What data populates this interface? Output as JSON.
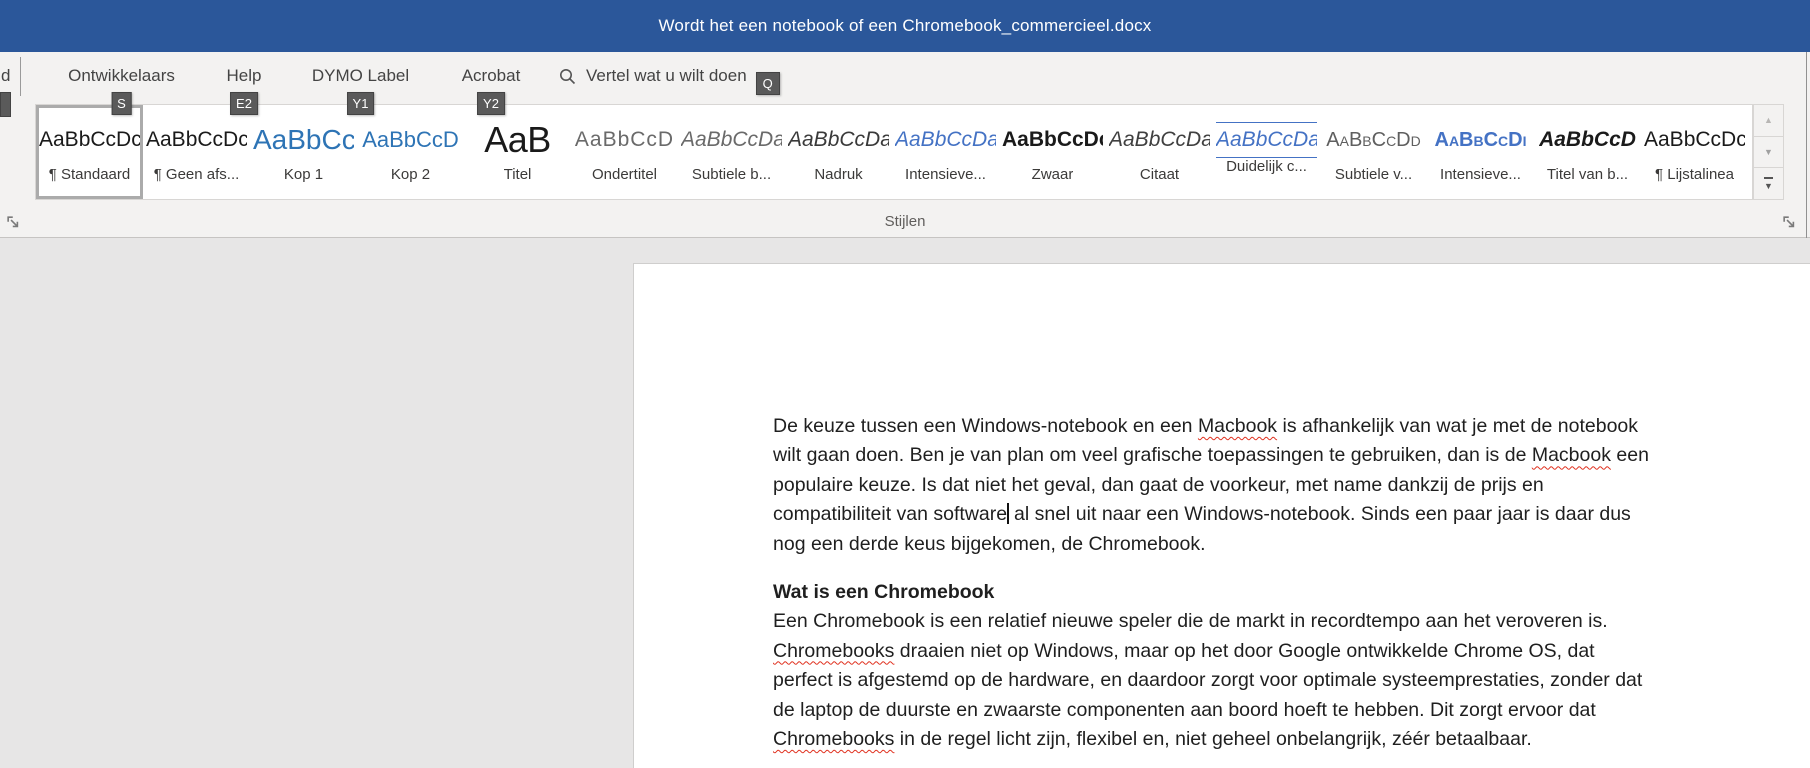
{
  "colors": {
    "title_bar_blue": "#2B579A",
    "ribbon_background": "#F3F2F1",
    "heading_blue": "#2E74B5",
    "intense_blue": "#4472C4",
    "keytip_background": "#5A5A5A",
    "spellcheck_red": "#E0301E"
  },
  "title_bar": {
    "document_title": "Wordt het een notebook of een Chromebook_commercieel.docx"
  },
  "menu": {
    "partial_tab_label": "d",
    "tabs": [
      {
        "label": "Ontwikkelaars",
        "keytip": "S"
      },
      {
        "label": "Help",
        "keytip": "E2"
      },
      {
        "label": "DYMO Label",
        "keytip": "Y1"
      },
      {
        "label": "Acrobat",
        "keytip": "Y2"
      }
    ],
    "tell_me_label": "Vertel wat u wilt doen",
    "tell_me_keytip": "Q",
    "tell_me_icon": "search-icon"
  },
  "styles_gallery": {
    "group_label": "Stijlen",
    "scroll": {
      "up": "▲",
      "down": "▼",
      "more": "▼"
    },
    "items": [
      {
        "preview": "AaBbCcDc",
        "label": "¶ Standaard",
        "kind": "normal",
        "selected": true
      },
      {
        "preview": "AaBbCcDc",
        "label": "¶ Geen afs...",
        "kind": "normal",
        "selected": false
      },
      {
        "preview": "AaBbCc",
        "label": "Kop 1",
        "kind": "kop1",
        "selected": false
      },
      {
        "preview": "AaBbCcD",
        "label": "Kop 2",
        "kind": "kop2",
        "selected": false
      },
      {
        "preview": "AaB",
        "label": "Titel",
        "kind": "titel",
        "selected": false
      },
      {
        "preview": "AaBbCcD",
        "label": "Ondertitel",
        "kind": "ondertitel",
        "selected": false
      },
      {
        "preview": "AaBbCcDa",
        "label": "Subtiele b...",
        "kind": "subtle-emph",
        "selected": false
      },
      {
        "preview": "AaBbCcDa",
        "label": "Nadruk",
        "kind": "emphasis",
        "selected": false
      },
      {
        "preview": "AaBbCcDa",
        "label": "Intensieve...",
        "kind": "intense-emph",
        "selected": false
      },
      {
        "preview": "AaBbCcDc",
        "label": "Zwaar",
        "kind": "strong",
        "selected": false
      },
      {
        "preview": "AaBbCcDa",
        "label": "Citaat",
        "kind": "quote",
        "selected": false
      },
      {
        "preview": "AaBbCcDa",
        "label": "Duidelijk c...",
        "kind": "intense-quote",
        "selected": false
      },
      {
        "preview": "AaBbCcDd",
        "label": "Subtiele v...",
        "kind": "subtle-ref",
        "selected": false
      },
      {
        "preview": "AaBbCcDi",
        "label": "Intensieve...",
        "kind": "intense-ref",
        "selected": false
      },
      {
        "preview": "AaBbCcD",
        "label": "Titel van b...",
        "kind": "book-title",
        "selected": false
      },
      {
        "preview": "AaBbCcDc",
        "label": "¶ Lijstalinea",
        "kind": "normal",
        "selected": false
      }
    ]
  },
  "document": {
    "paragraphs": [
      {
        "kind": "body",
        "lines": [
          [
            {
              "t": "De keuze tussen een Windows-notebook en een "
            },
            {
              "t": "Macbook",
              "m": true
            },
            {
              "t": " is afhankelijk van wat je met de notebook"
            }
          ],
          [
            {
              "t": "wilt gaan doen. Ben je van plan om veel grafische toepassingen te gebruiken, dan is de "
            },
            {
              "t": "Macbook",
              "m": true
            },
            {
              "t": " een"
            }
          ],
          [
            {
              "t": "populaire keuze. Is dat niet het geval, dan gaat de voorkeur, met name dankzij de prijs en"
            }
          ],
          [
            {
              "t": "compatibiliteit van software",
              "caret": true
            },
            {
              "t": " al snel uit naar een Windows-notebook. Sinds een paar jaar is daar dus"
            }
          ],
          [
            {
              "t": "nog een derde keus bijgekomen, de Chromebook."
            }
          ]
        ]
      },
      {
        "kind": "heading",
        "lines": [
          [
            {
              "t": "Wat is een Chromebook"
            }
          ]
        ]
      },
      {
        "kind": "body",
        "lines": [
          [
            {
              "t": "Een Chromebook is een relatief nieuwe speler die de markt in recordtempo aan het veroveren is."
            }
          ],
          [
            {
              "t": "Chromebooks",
              "m": true
            },
            {
              "t": " draaien niet op Windows, maar op het door Google ontwikkelde Chrome OS, dat"
            }
          ],
          [
            {
              "t": "perfect is afgestemd op de hardware, en daardoor zorgt voor optimale systeemprestaties, zonder dat"
            }
          ],
          [
            {
              "t": "de laptop de duurste en zwaarste componenten aan boord hoeft te hebben. Dit zorgt ervoor dat"
            }
          ],
          [
            {
              "t": "Chromebooks",
              "m": true
            },
            {
              "t": " in de regel licht zijn, flexibel en, niet geheel onbelangrijk, zéér betaalbaar."
            }
          ]
        ]
      }
    ]
  }
}
